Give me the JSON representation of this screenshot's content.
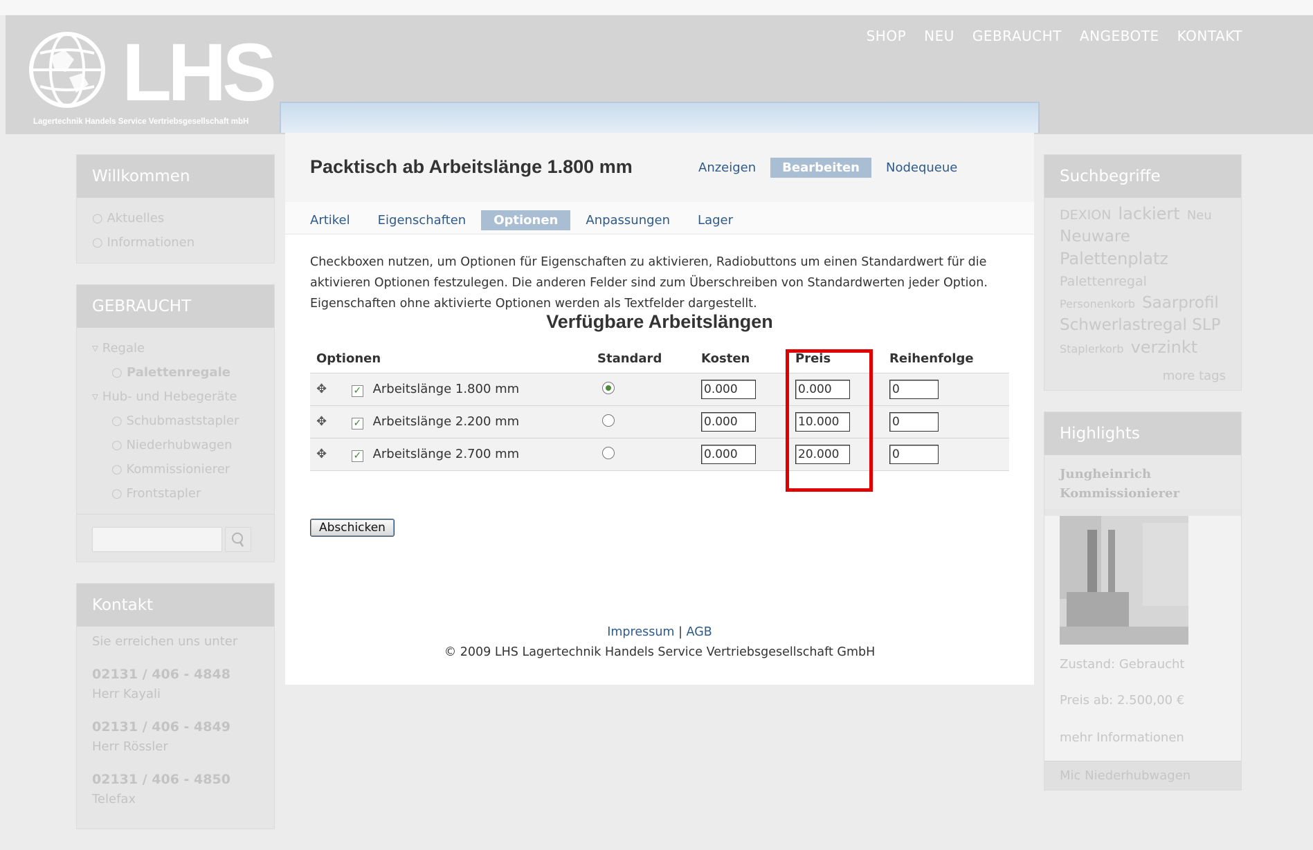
{
  "header": {
    "logo_text": "LHS",
    "logo_subtitle": "Lagertechnik Handels Service Vertriebsgesellschaft mbH",
    "nav": [
      "SHOP",
      "NEU",
      "GEBRAUCHT",
      "ANGEBOTE",
      "KONTAKT"
    ]
  },
  "sidebar_left": {
    "welcome": {
      "title": "Willkommen",
      "items": [
        "Aktuelles",
        "Informationen"
      ]
    },
    "used": {
      "title": "GEBRAUCHT",
      "items": [
        {
          "label": "Regale",
          "marker": "▿"
        },
        {
          "label": "Palettenregale",
          "marker": "○"
        },
        {
          "label": "Hub- und Hebegeräte",
          "marker": "▿"
        },
        {
          "label": "Schubmaststapler",
          "marker": "○"
        },
        {
          "label": "Niederhubwagen",
          "marker": "○"
        },
        {
          "label": "Kommissionierer",
          "marker": "○"
        },
        {
          "label": "Frontstapler",
          "marker": "○"
        }
      ]
    },
    "contact": {
      "title": "Kontakt",
      "intro": "Sie erreichen uns unter",
      "entries": [
        {
          "number": "02131 / 406 - 4848",
          "name": "Herr Kayali"
        },
        {
          "number": "02131 / 406 - 4849",
          "name": "Herr Rössler"
        },
        {
          "number": "02131 / 406 - 4850",
          "name": "Telefax"
        }
      ]
    }
  },
  "sidebar_right": {
    "tags_title": "Suchbegriffe",
    "tags": [
      {
        "text": "DEXION",
        "size": 19
      },
      {
        "text": "lackiert",
        "size": 24
      },
      {
        "text": "Neu",
        "size": 18
      },
      {
        "text": "Neuware",
        "size": 23
      },
      {
        "text": "Palettenplatz",
        "size": 24
      },
      {
        "text": "Palettenregal",
        "size": 19
      },
      {
        "text": "Personenkorb",
        "size": 16
      },
      {
        "text": "Saarprofil",
        "size": 23
      },
      {
        "text": "Schwerlastregal SLP",
        "size": 23
      },
      {
        "text": "Staplerkorb",
        "size": 16
      },
      {
        "text": "verzinkt",
        "size": 24
      }
    ],
    "more_tags": "more tags",
    "highlights_title": "Highlights",
    "highlight_name": "Jungheinrich Kommissionierer",
    "highlight_condition": "Zustand: Gebraucht",
    "highlight_price": "Preis ab: 2.500,00 €",
    "highlight_more": "mehr Informationen",
    "highlight_next": "Mic Niederhubwagen"
  },
  "node": {
    "title": "Packtisch ab Arbeitslänge 1.800 mm",
    "primary_tabs": [
      "Anzeigen",
      "Bearbeiten",
      "Nodequeue"
    ],
    "primary_active": 1,
    "secondary_tabs": [
      "Artikel",
      "Eigenschaften",
      "Optionen",
      "Anpassungen",
      "Lager"
    ],
    "secondary_active": 2,
    "help": "Checkboxen nutzen, um Optionen für Eigenschaften zu aktivieren, Radiobuttons um einen Standardwert für die aktivieren Optionen festzulegen. Die anderen Felder sind zum Überschreiben von Standardwerten jeder Option. Eigenschaften ohne aktivierte Optionen werden als Textfelder dargestellt.",
    "caption": "Verfügbare Arbeitslängen",
    "columns": [
      "Optionen",
      "Standard",
      "Kosten",
      "Preis",
      "Reihenfolge"
    ],
    "rows": [
      {
        "label": "Arbeitslänge 1.800 mm",
        "checked": true,
        "default": true,
        "kosten": "0.000",
        "preis": "0.000",
        "reihenfolge": "0"
      },
      {
        "label": "Arbeitslänge 2.200 mm",
        "checked": true,
        "default": false,
        "kosten": "0.000",
        "preis": "10.000",
        "reihenfolge": "0"
      },
      {
        "label": "Arbeitslänge 2.700 mm",
        "checked": true,
        "default": false,
        "kosten": "0.000",
        "preis": "20.000",
        "reihenfolge": "0"
      }
    ],
    "submit_label": "Abschicken",
    "footer_links": [
      "Impressum",
      "AGB"
    ],
    "footer_sep": "|",
    "copyright": "© 2009 LHS Lagertechnik Handels Service Vertriebsgesellschaft GmbH"
  },
  "colors": {
    "accent": "#a9bed3",
    "link": "#2d5a8a",
    "highlight_border": "#e00000"
  }
}
